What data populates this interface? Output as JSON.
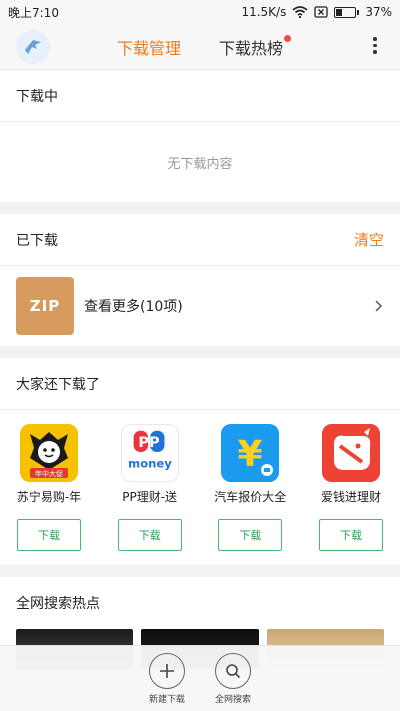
{
  "statusbar": {
    "time": "晚上7:10",
    "network_speed": "11.5K/s",
    "battery": "37%",
    "battery_level": 0.37
  },
  "navbar": {
    "logo_icon": "bird-logo-icon",
    "tabs": [
      {
        "label": "下载管理",
        "active": true
      },
      {
        "label": "下载热榜",
        "active": false,
        "badge_dot": true
      }
    ],
    "menu_icon": "more-vert-icon"
  },
  "downloading": {
    "title": "下载中",
    "empty_text": "无下载内容"
  },
  "downloaded": {
    "title": "已下载",
    "clear_label": "清空",
    "zip_label": "ZIP",
    "more_text": "查看更多(10项)"
  },
  "recommend": {
    "title": "大家还下载了",
    "apps": [
      {
        "name": "苏宁易购-年",
        "button": "下载",
        "icon": "suning-icon",
        "icon_text": "年中大促"
      },
      {
        "name": "PP理财-送",
        "button": "下载",
        "icon": "pp-money-icon",
        "icon_text_top": "PP",
        "icon_text_bottom": "money"
      },
      {
        "name": "汽车报价大全",
        "button": "下载",
        "icon": "car-price-icon",
        "icon_text": "¥"
      },
      {
        "name": "爱钱进理财",
        "button": "下载",
        "icon": "iqianjin-icon"
      }
    ]
  },
  "hot": {
    "title": "全网搜索热点"
  },
  "bottombar": {
    "items": [
      {
        "label": "新建下载",
        "icon": "plus-icon"
      },
      {
        "label": "全网搜索",
        "icon": "search-icon"
      }
    ]
  },
  "colors": {
    "accent": "#f07b1f",
    "download_green": "#49b96e",
    "badge_red": "#f24d3a",
    "zip_bg": "#d79b5e"
  }
}
